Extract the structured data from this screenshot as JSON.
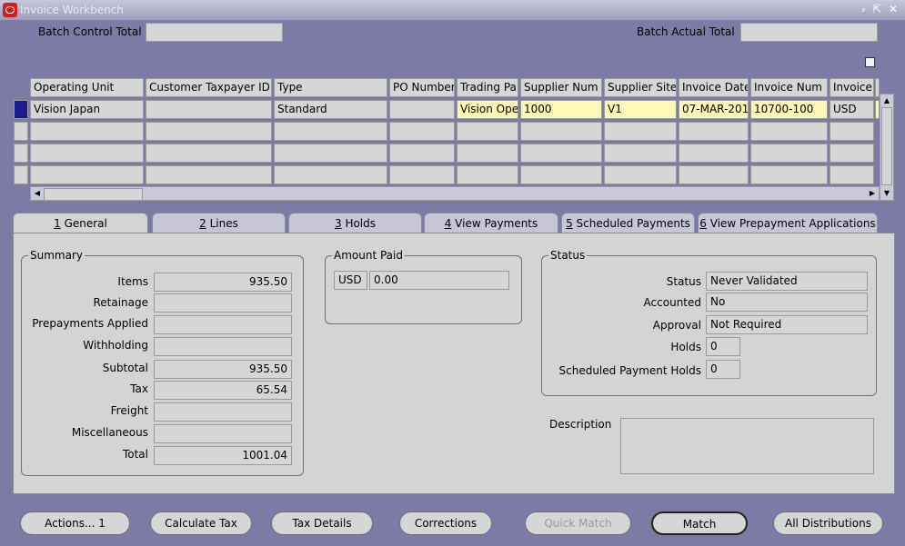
{
  "window": {
    "title": "Invoice Workbench",
    "controls": "⸗ ⇱ ✕"
  },
  "header": {
    "batch_control_total_label": "Batch Control Total",
    "batch_control_total_value": "",
    "batch_actual_total_label": "Batch Actual Total",
    "batch_actual_total_value": ""
  },
  "grid": {
    "columns": [
      "Operating Unit",
      "Customer Taxpayer ID",
      "Type",
      "PO Number",
      "Trading Pa",
      "Supplier Num",
      "Supplier Site",
      "Invoice Date",
      "Invoice Num",
      "Invoice"
    ],
    "rows": [
      [
        "Vision Japan",
        "",
        "Standard",
        "",
        "Vision Ope",
        "1000",
        "V1",
        "07-MAR-201",
        "10700-100",
        "USD"
      ],
      [
        "",
        "",
        "",
        "",
        "",
        "",
        "",
        "",
        "",
        ""
      ],
      [
        "",
        "",
        "",
        "",
        "",
        "",
        "",
        "",
        "",
        ""
      ],
      [
        "",
        "",
        "",
        "",
        "",
        "",
        "",
        "",
        "",
        ""
      ]
    ]
  },
  "tabs": [
    {
      "num": "1",
      "label": " General"
    },
    {
      "num": "2",
      "label": " Lines"
    },
    {
      "num": "3",
      "label": " Holds"
    },
    {
      "num": "4",
      "label": " View Payments"
    },
    {
      "num": "5",
      "label": " Scheduled Payments"
    },
    {
      "num": "6",
      "label": " View Prepayment Applications"
    }
  ],
  "summary": {
    "title": "Summary",
    "items_label": "Items",
    "items_value": "935.50",
    "retainage_label": "Retainage",
    "retainage_value": "",
    "prepayments_label": "Prepayments Applied",
    "prepayments_value": "",
    "withholding_label": "Withholding",
    "withholding_value": "",
    "subtotal_label": "Subtotal",
    "subtotal_value": "935.50",
    "tax_label": "Tax",
    "tax_value": "65.54",
    "freight_label": "Freight",
    "freight_value": "",
    "misc_label": "Miscellaneous",
    "misc_value": "",
    "total_label": "Total",
    "total_value": "1001.04"
  },
  "amount_paid": {
    "title": "Amount Paid",
    "currency": "USD",
    "value": "0.00"
  },
  "status": {
    "title": "Status",
    "status_label": "Status",
    "status_value": "Never Validated",
    "accounted_label": "Accounted",
    "accounted_value": "No",
    "approval_label": "Approval",
    "approval_value": "Not Required",
    "holds_label": "Holds",
    "holds_value": "0",
    "sched_holds_label": "Scheduled Payment Holds",
    "sched_holds_value": "0"
  },
  "description": {
    "label": "Description",
    "value": ""
  },
  "buttons": {
    "actions": "Actions... 1",
    "calculate_tax": "Calculate Tax",
    "tax_details": "Tax Details",
    "corrections": "Corrections",
    "quick_match": "Quick Match",
    "match": "Match",
    "all_distributions": "All Distributions"
  },
  "colors": {
    "selected_row": "#1b1b8e",
    "required_field": "#fef7b6",
    "background": "#7b7ba5"
  }
}
